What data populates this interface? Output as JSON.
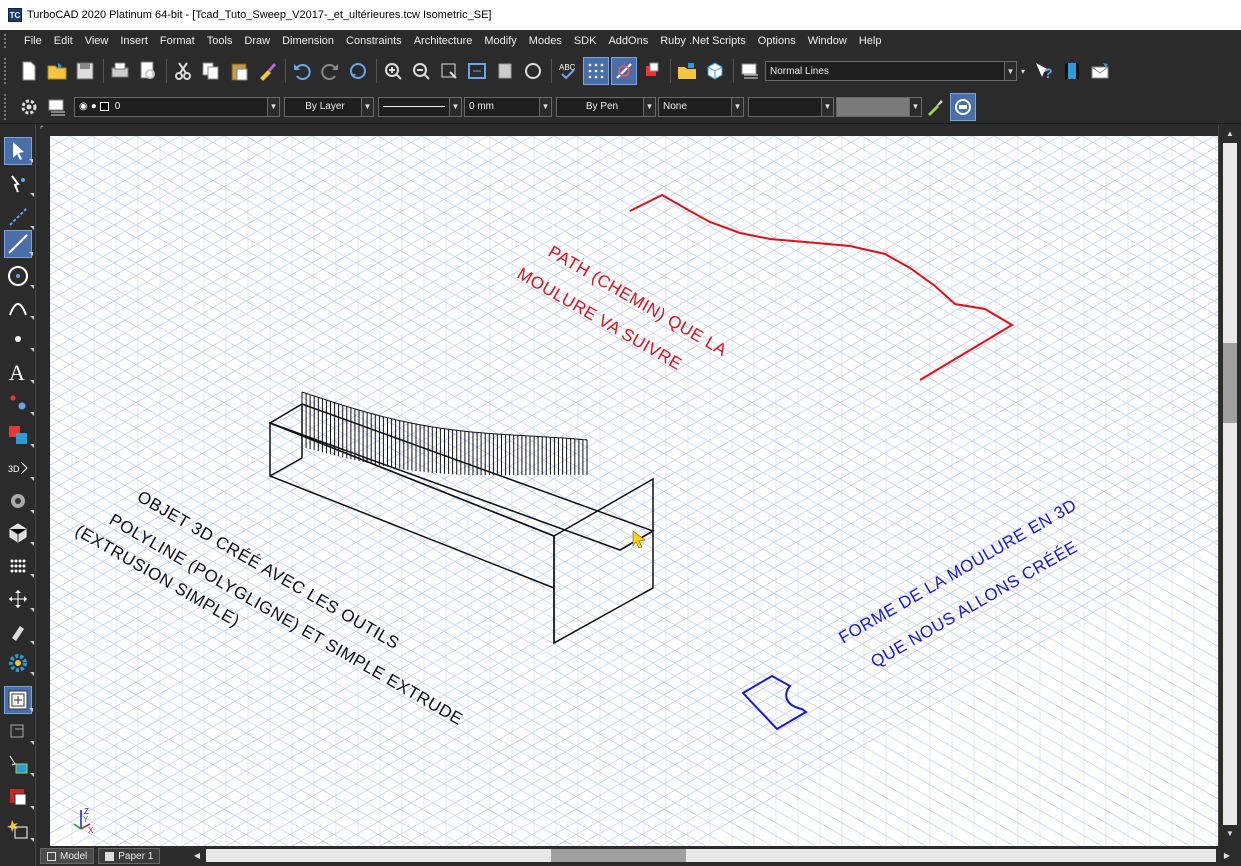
{
  "window": {
    "title": "TurboCAD 2020 Platinum 64-bit - [Tcad_Tuto_Sweep_V2017-_et_ultérieures.tcw Isometric_SE]",
    "app_icon_text": "TC"
  },
  "menu": [
    "File",
    "Edit",
    "View",
    "Insert",
    "Format",
    "Tools",
    "Draw",
    "Dimension",
    "Constraints",
    "Architecture",
    "Modify",
    "Modes",
    "SDK",
    "AddOns",
    "Ruby .Net Scripts",
    "Options",
    "Window",
    "Help"
  ],
  "toolbar": {
    "line_style_value": "Normal Lines"
  },
  "properties_bar": {
    "layer_value": "0",
    "color_value": "By Layer",
    "thickness_value": "0 mm",
    "pen_value": "By Pen",
    "fill_value": "None",
    "pattern_value": ""
  },
  "tabs": [
    {
      "label": "Model",
      "active": true
    },
    {
      "label": "Paper 1",
      "active": false
    }
  ],
  "annotations": {
    "path_line1": "PATH (CHEMIN) QUE LA",
    "path_line2": "MOULURE VA SUIVRE",
    "shape_line1": "FORME DE LA MOULURE EN 3D",
    "shape_line2": "QUE NOUS ALLONS CRÉÉE",
    "object_line1": "OBJET 3D CRÉÉ AVEC LES OUTILS",
    "object_line2": "POLYLINE (POLYGLIGNE) ET SIMPLE EXTRUDE",
    "object_line3": "(EXTRUSION SIMPLE)"
  },
  "colors": {
    "path_red": "#e0101a",
    "shape_blue": "#1818d8",
    "grid_blue": "#b9c7ef",
    "ui_dark": "#2b2b2b",
    "active_tool": "#4a6ea8"
  },
  "axis_labels": {
    "z": "Z",
    "x": "X",
    "y": "Y"
  }
}
